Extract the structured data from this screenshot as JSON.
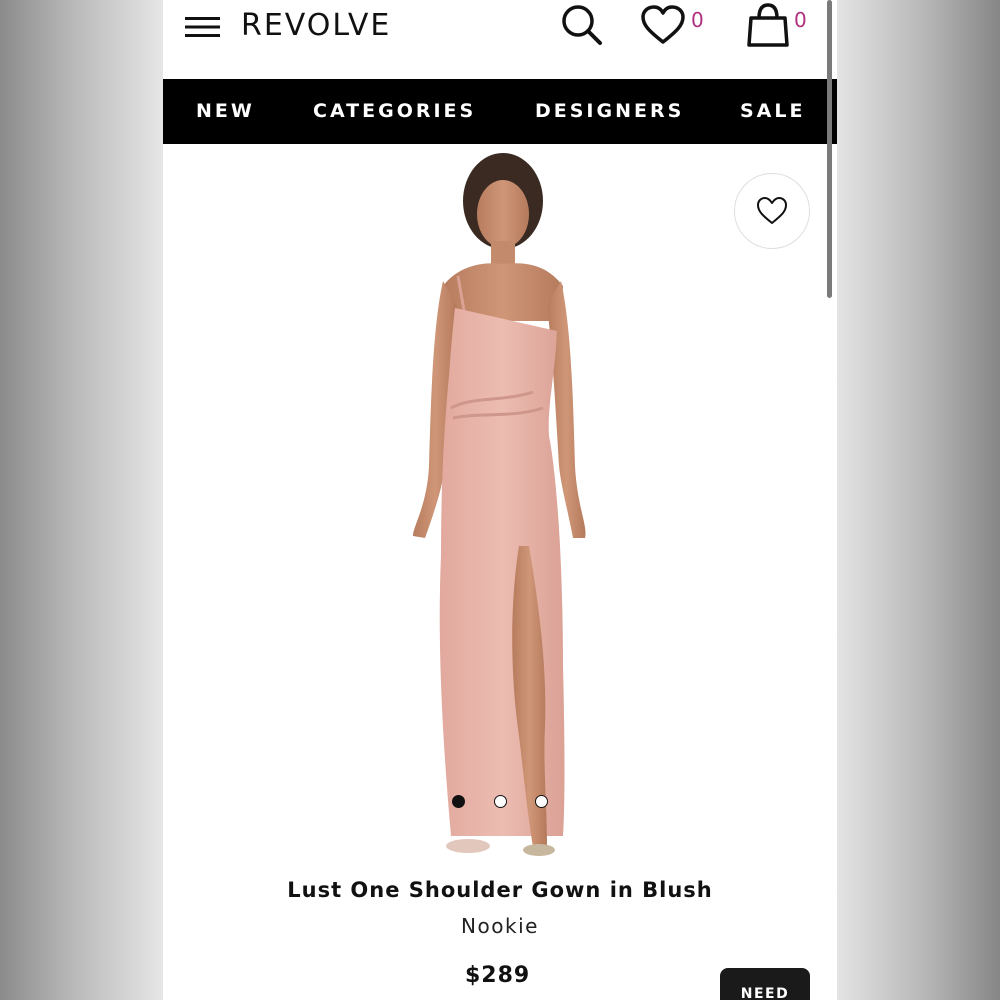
{
  "header": {
    "logo": "REVOLVE",
    "wishlist_count": "0",
    "bag_count": "0",
    "icons": [
      "menu-icon",
      "search-icon",
      "heart-icon",
      "bag-icon"
    ]
  },
  "nav": {
    "items": [
      "NEW",
      "CATEGORIES",
      "DESIGNERS",
      "SALE"
    ]
  },
  "product": {
    "title": "Lust One Shoulder Gown in Blush",
    "brand": "Nookie",
    "price": "$289",
    "image_count": 3,
    "active_image": 1,
    "action_label": "NEED"
  },
  "colors": {
    "accent": "#b0307f",
    "nav_bg": "#000000",
    "dress": "#e8b1a6"
  }
}
